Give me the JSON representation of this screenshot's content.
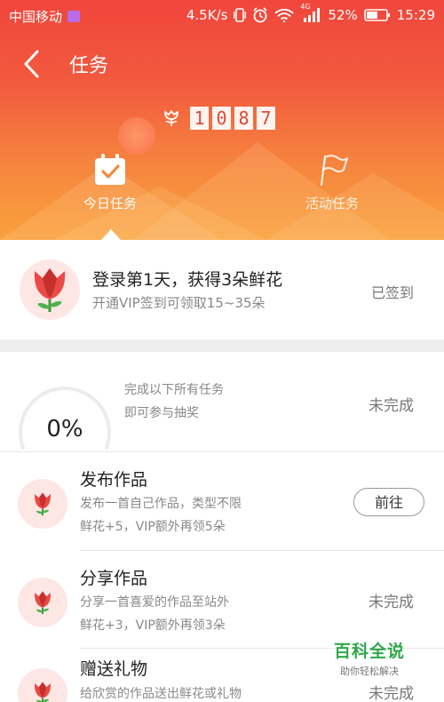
{
  "status_bar": {
    "carrier": "中国移动",
    "speed": "4.5K/s",
    "battery": "52%",
    "time": "15:29",
    "network": "4G",
    "icons": [
      "sim-badge-icon",
      "vibrate-icon",
      "alarm-icon",
      "wifi-icon",
      "signal-icon",
      "battery-icon"
    ]
  },
  "nav": {
    "back_icon": "chevron-left-icon",
    "title": "任务"
  },
  "score": {
    "icon": "flower-icon",
    "digits": [
      "1",
      "0",
      "8",
      "7"
    ]
  },
  "tabs": [
    {
      "label": "今日任务",
      "icon": "calendar-check-icon",
      "active": true
    },
    {
      "label": "活动任务",
      "icon": "flag-icon",
      "active": false
    }
  ],
  "signin": {
    "title": "登录第1天，获得3朵鲜花",
    "subtitle": "开通VIP签到可领取15~35朵",
    "status": "已签到"
  },
  "progress": {
    "percent": "0%",
    "value": 0,
    "line1": "完成以下所有任务",
    "line2": "即可参与抽奖",
    "status": "未完成"
  },
  "tasks": [
    {
      "name": "发布作品",
      "desc1": "发布一首自己作品，类型不限",
      "desc2": "鲜花+5，VIP额外再领5朵",
      "action": "前往",
      "action_type": "button"
    },
    {
      "name": "分享作品",
      "desc1": "分享一首喜爱的作品至站外",
      "desc2": "鲜花+3，VIP额外再领3朵",
      "action": "未完成",
      "action_type": "status"
    },
    {
      "name": "赠送礼物",
      "desc1": "给欣赏的作品送出鲜花或礼物",
      "desc2": "",
      "action": "未完成",
      "action_type": "status"
    }
  ],
  "watermark": {
    "title": "百科全说",
    "subtitle": "助你轻松解决"
  },
  "colors": {
    "header_top": "#f0463c",
    "header_bottom": "#f9a13c",
    "accent_green": "#2fa84a",
    "flower_bg": "#fde7e5"
  }
}
